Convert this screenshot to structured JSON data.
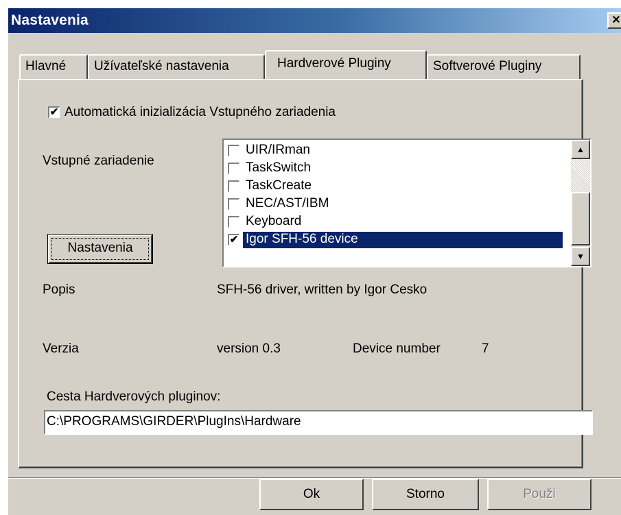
{
  "window": {
    "title": "Nastavenia",
    "close_symbol": "×"
  },
  "tabs": [
    {
      "label": "Hlavné",
      "active": false
    },
    {
      "label": "Užívateľské nastavenia",
      "active": false
    },
    {
      "label": "Hardverové Pluginy",
      "active": true
    },
    {
      "label": "Softverové Pluginy",
      "active": false
    }
  ],
  "panel": {
    "auto_init_label": "Automatická inizializácia Vstupného zariadenia",
    "auto_init_checked": true,
    "input_device_label": "Vstupné zariadenie",
    "devices": [
      {
        "name": "UIR/IRman",
        "checked": false,
        "selected": false
      },
      {
        "name": "TaskSwitch",
        "checked": false,
        "selected": false
      },
      {
        "name": "TaskCreate",
        "checked": false,
        "selected": false
      },
      {
        "name": "NEC/AST/IBM",
        "checked": false,
        "selected": false
      },
      {
        "name": "Keyboard",
        "checked": false,
        "selected": false
      },
      {
        "name": "Igor SFH-56 device",
        "checked": true,
        "selected": true
      }
    ],
    "settings_button": "Nastavenia",
    "description_label": "Popis",
    "description_value": "SFH-56 driver, written by Igor Cesko",
    "version_label": "Verzia",
    "version_value": "version 0.3",
    "device_number_label": "Device number",
    "device_number_value": "7",
    "path_label": "Cesta Hardverových pluginov:",
    "path_value": "C:\\PROGRAMS\\GIRDER\\PlugIns\\Hardware"
  },
  "buttons": {
    "ok": "Ok",
    "cancel": "Storno",
    "apply": "Použi"
  },
  "icons": {
    "check": "✔",
    "scroll_up": "▲",
    "scroll_down": "▼"
  },
  "colors": {
    "title_active": "#0a246a",
    "selection": "#0a246a",
    "face": "#d4d0c8"
  }
}
